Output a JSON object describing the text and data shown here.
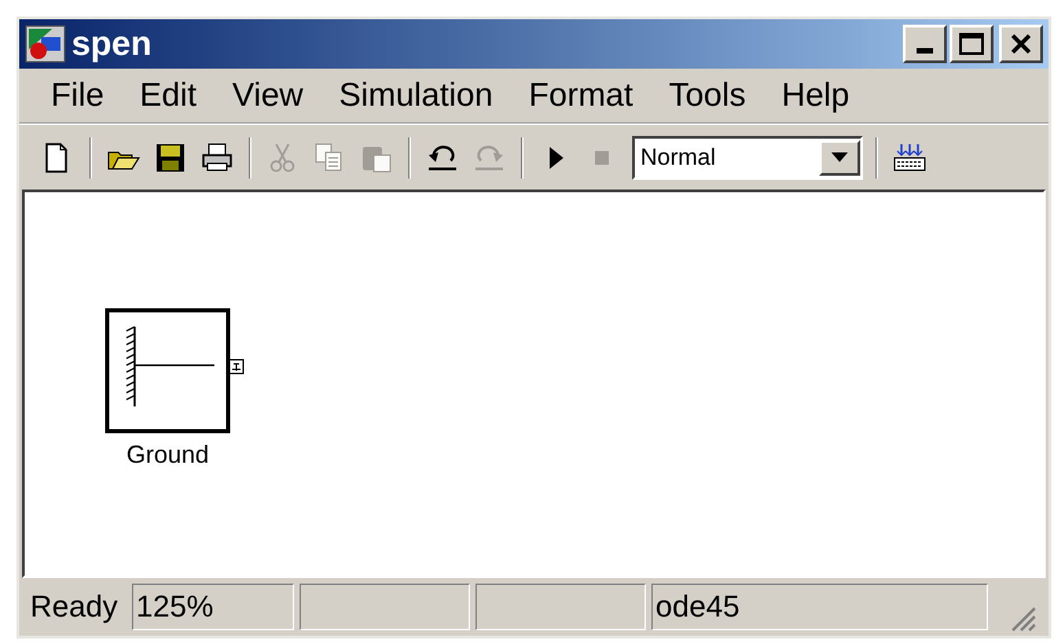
{
  "window": {
    "title": "spen"
  },
  "menu": [
    "File",
    "Edit",
    "View",
    "Simulation",
    "Format",
    "Tools",
    "Help"
  ],
  "toolbar": [
    {
      "kind": "new",
      "disabled": false
    },
    {
      "kind": "sep"
    },
    {
      "kind": "open",
      "disabled": false
    },
    {
      "kind": "save",
      "disabled": false
    },
    {
      "kind": "print",
      "disabled": false
    },
    {
      "kind": "sep"
    },
    {
      "kind": "cut",
      "disabled": true
    },
    {
      "kind": "copy",
      "disabled": true
    },
    {
      "kind": "paste",
      "disabled": true
    },
    {
      "kind": "sep"
    },
    {
      "kind": "undo",
      "disabled": false
    },
    {
      "kind": "redo",
      "disabled": true
    },
    {
      "kind": "sep"
    },
    {
      "kind": "play",
      "disabled": false
    },
    {
      "kind": "stop",
      "disabled": true
    },
    {
      "kind": "mode",
      "value": "Normal"
    },
    {
      "kind": "sep"
    },
    {
      "kind": "library",
      "disabled": false
    }
  ],
  "blocks": [
    {
      "label": "Ground"
    }
  ],
  "status_bar": {
    "message": "Ready",
    "panels": [
      {
        "kind": "text",
        "text": "125%"
      },
      {
        "kind": "blank"
      },
      {
        "kind": "blank"
      },
      {
        "kind": "text",
        "text": "ode45"
      }
    ]
  }
}
